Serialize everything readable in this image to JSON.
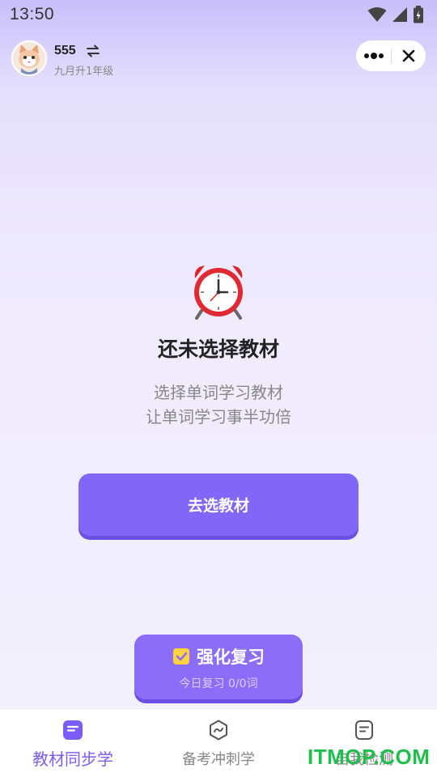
{
  "status_bar": {
    "time": "13:50",
    "icons": [
      "wifi-icon",
      "signal-icon",
      "battery-icon"
    ]
  },
  "header": {
    "user_name": "555",
    "grade": "九月升1年级",
    "capsule_icons": [
      "more-dots-icon",
      "close-icon"
    ]
  },
  "empty_state": {
    "icon": "alarm-clock-icon",
    "title": "还未选择教材",
    "desc_line1": "选择单词学习教材",
    "desc_line2": "让单词学习事半功倍"
  },
  "choose_button": {
    "label": "去选教材"
  },
  "review_button": {
    "title": "强化复习",
    "subtitle": "今日复习 0/0词"
  },
  "tabs": [
    {
      "label": "教材同步学",
      "icon": "book-icon",
      "active": true
    },
    {
      "label": "备考冲刺学",
      "icon": "sprint-icon",
      "active": false
    },
    {
      "label": "自我检测",
      "icon": "note-icon",
      "active": false
    }
  ],
  "watermark": "ITMOP.COM",
  "colors": {
    "accent": "#7b5cf5",
    "button": "#8167f7",
    "bg_top": "#c8bffb"
  }
}
